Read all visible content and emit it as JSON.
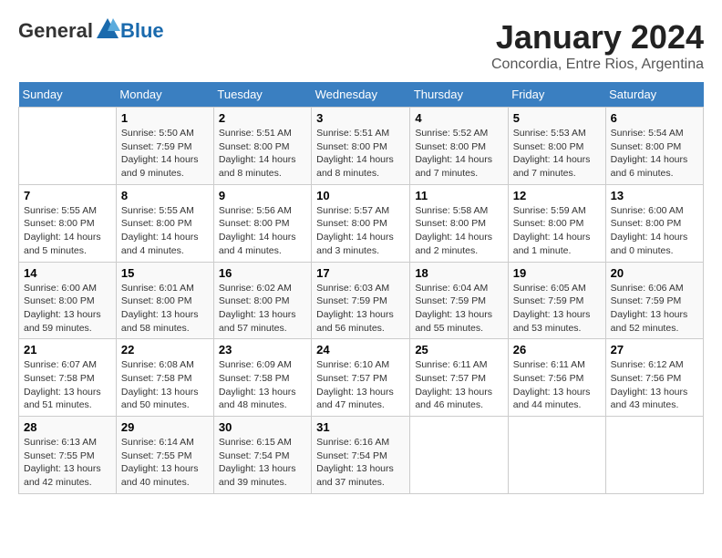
{
  "header": {
    "logo_general": "General",
    "logo_blue": "Blue",
    "month_year": "January 2024",
    "location": "Concordia, Entre Rios, Argentina"
  },
  "weekdays": [
    "Sunday",
    "Monday",
    "Tuesday",
    "Wednesday",
    "Thursday",
    "Friday",
    "Saturday"
  ],
  "weeks": [
    [
      {
        "day": "",
        "info": ""
      },
      {
        "day": "1",
        "info": "Sunrise: 5:50 AM\nSunset: 7:59 PM\nDaylight: 14 hours\nand 9 minutes."
      },
      {
        "day": "2",
        "info": "Sunrise: 5:51 AM\nSunset: 8:00 PM\nDaylight: 14 hours\nand 8 minutes."
      },
      {
        "day": "3",
        "info": "Sunrise: 5:51 AM\nSunset: 8:00 PM\nDaylight: 14 hours\nand 8 minutes."
      },
      {
        "day": "4",
        "info": "Sunrise: 5:52 AM\nSunset: 8:00 PM\nDaylight: 14 hours\nand 7 minutes."
      },
      {
        "day": "5",
        "info": "Sunrise: 5:53 AM\nSunset: 8:00 PM\nDaylight: 14 hours\nand 7 minutes."
      },
      {
        "day": "6",
        "info": "Sunrise: 5:54 AM\nSunset: 8:00 PM\nDaylight: 14 hours\nand 6 minutes."
      }
    ],
    [
      {
        "day": "7",
        "info": "Sunrise: 5:55 AM\nSunset: 8:00 PM\nDaylight: 14 hours\nand 5 minutes."
      },
      {
        "day": "8",
        "info": "Sunrise: 5:55 AM\nSunset: 8:00 PM\nDaylight: 14 hours\nand 4 minutes."
      },
      {
        "day": "9",
        "info": "Sunrise: 5:56 AM\nSunset: 8:00 PM\nDaylight: 14 hours\nand 4 minutes."
      },
      {
        "day": "10",
        "info": "Sunrise: 5:57 AM\nSunset: 8:00 PM\nDaylight: 14 hours\nand 3 minutes."
      },
      {
        "day": "11",
        "info": "Sunrise: 5:58 AM\nSunset: 8:00 PM\nDaylight: 14 hours\nand 2 minutes."
      },
      {
        "day": "12",
        "info": "Sunrise: 5:59 AM\nSunset: 8:00 PM\nDaylight: 14 hours\nand 1 minute."
      },
      {
        "day": "13",
        "info": "Sunrise: 6:00 AM\nSunset: 8:00 PM\nDaylight: 14 hours\nand 0 minutes."
      }
    ],
    [
      {
        "day": "14",
        "info": "Sunrise: 6:00 AM\nSunset: 8:00 PM\nDaylight: 13 hours\nand 59 minutes."
      },
      {
        "day": "15",
        "info": "Sunrise: 6:01 AM\nSunset: 8:00 PM\nDaylight: 13 hours\nand 58 minutes."
      },
      {
        "day": "16",
        "info": "Sunrise: 6:02 AM\nSunset: 8:00 PM\nDaylight: 13 hours\nand 57 minutes."
      },
      {
        "day": "17",
        "info": "Sunrise: 6:03 AM\nSunset: 7:59 PM\nDaylight: 13 hours\nand 56 minutes."
      },
      {
        "day": "18",
        "info": "Sunrise: 6:04 AM\nSunset: 7:59 PM\nDaylight: 13 hours\nand 55 minutes."
      },
      {
        "day": "19",
        "info": "Sunrise: 6:05 AM\nSunset: 7:59 PM\nDaylight: 13 hours\nand 53 minutes."
      },
      {
        "day": "20",
        "info": "Sunrise: 6:06 AM\nSunset: 7:59 PM\nDaylight: 13 hours\nand 52 minutes."
      }
    ],
    [
      {
        "day": "21",
        "info": "Sunrise: 6:07 AM\nSunset: 7:58 PM\nDaylight: 13 hours\nand 51 minutes."
      },
      {
        "day": "22",
        "info": "Sunrise: 6:08 AM\nSunset: 7:58 PM\nDaylight: 13 hours\nand 50 minutes."
      },
      {
        "day": "23",
        "info": "Sunrise: 6:09 AM\nSunset: 7:58 PM\nDaylight: 13 hours\nand 48 minutes."
      },
      {
        "day": "24",
        "info": "Sunrise: 6:10 AM\nSunset: 7:57 PM\nDaylight: 13 hours\nand 47 minutes."
      },
      {
        "day": "25",
        "info": "Sunrise: 6:11 AM\nSunset: 7:57 PM\nDaylight: 13 hours\nand 46 minutes."
      },
      {
        "day": "26",
        "info": "Sunrise: 6:11 AM\nSunset: 7:56 PM\nDaylight: 13 hours\nand 44 minutes."
      },
      {
        "day": "27",
        "info": "Sunrise: 6:12 AM\nSunset: 7:56 PM\nDaylight: 13 hours\nand 43 minutes."
      }
    ],
    [
      {
        "day": "28",
        "info": "Sunrise: 6:13 AM\nSunset: 7:55 PM\nDaylight: 13 hours\nand 42 minutes."
      },
      {
        "day": "29",
        "info": "Sunrise: 6:14 AM\nSunset: 7:55 PM\nDaylight: 13 hours\nand 40 minutes."
      },
      {
        "day": "30",
        "info": "Sunrise: 6:15 AM\nSunset: 7:54 PM\nDaylight: 13 hours\nand 39 minutes."
      },
      {
        "day": "31",
        "info": "Sunrise: 6:16 AM\nSunset: 7:54 PM\nDaylight: 13 hours\nand 37 minutes."
      },
      {
        "day": "",
        "info": ""
      },
      {
        "day": "",
        "info": ""
      },
      {
        "day": "",
        "info": ""
      }
    ]
  ]
}
